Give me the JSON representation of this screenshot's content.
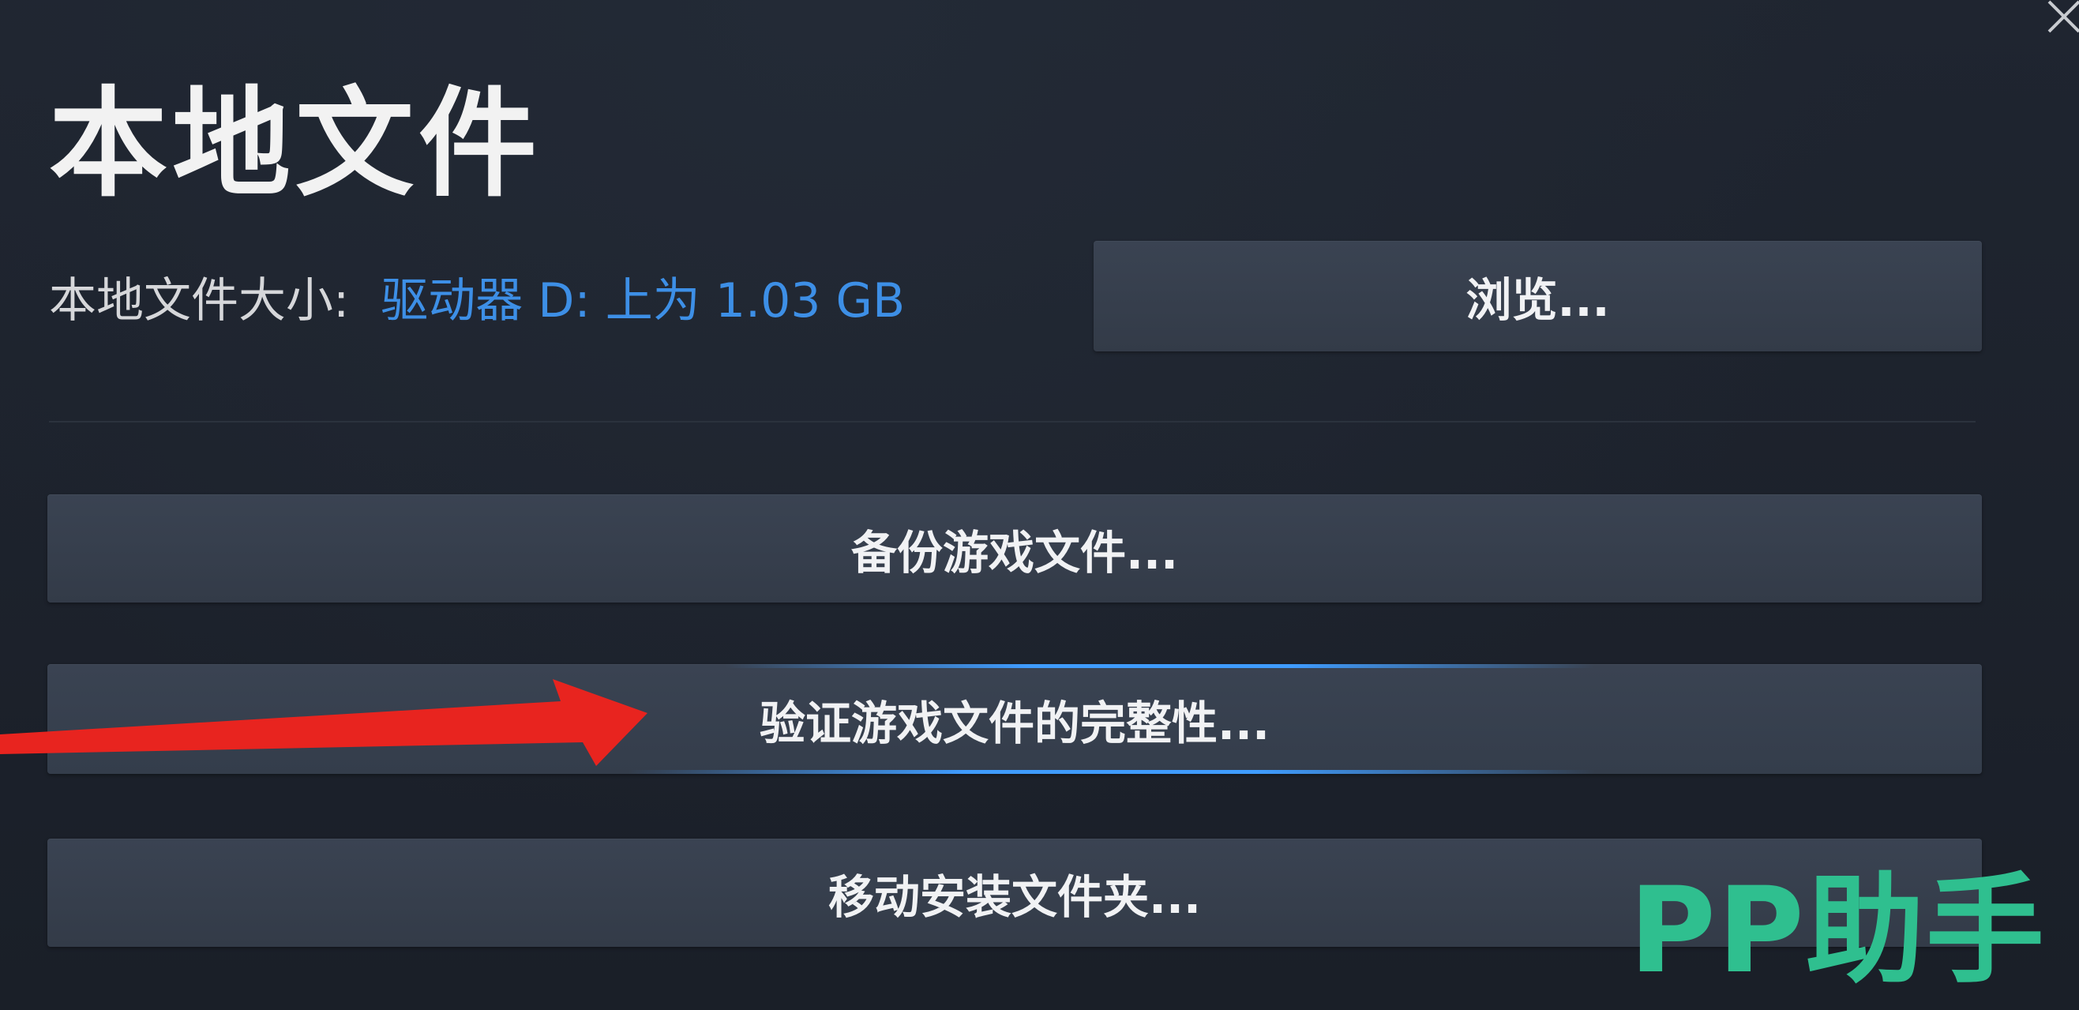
{
  "dialog": {
    "title": "本地文件",
    "close_icon": "close-icon"
  },
  "local_size": {
    "label": "本地文件大小:",
    "value": "驱动器 D: 上为 1.03 GB",
    "value_color": "#3d8fe6"
  },
  "buttons": {
    "browse": "浏览...",
    "backup": "备份游戏文件...",
    "verify": "验证游戏文件的完整性...",
    "move": "移动安装文件夹..."
  },
  "annotation": {
    "arrow_icon": "red-arrow-icon",
    "arrow_color": "#e8241f"
  },
  "watermark": {
    "text": "PP助手",
    "color": "#2fbf8f"
  },
  "theme": {
    "background": "#1b2029",
    "button_bg": "#3a4352",
    "highlight": "#3f9cff"
  }
}
